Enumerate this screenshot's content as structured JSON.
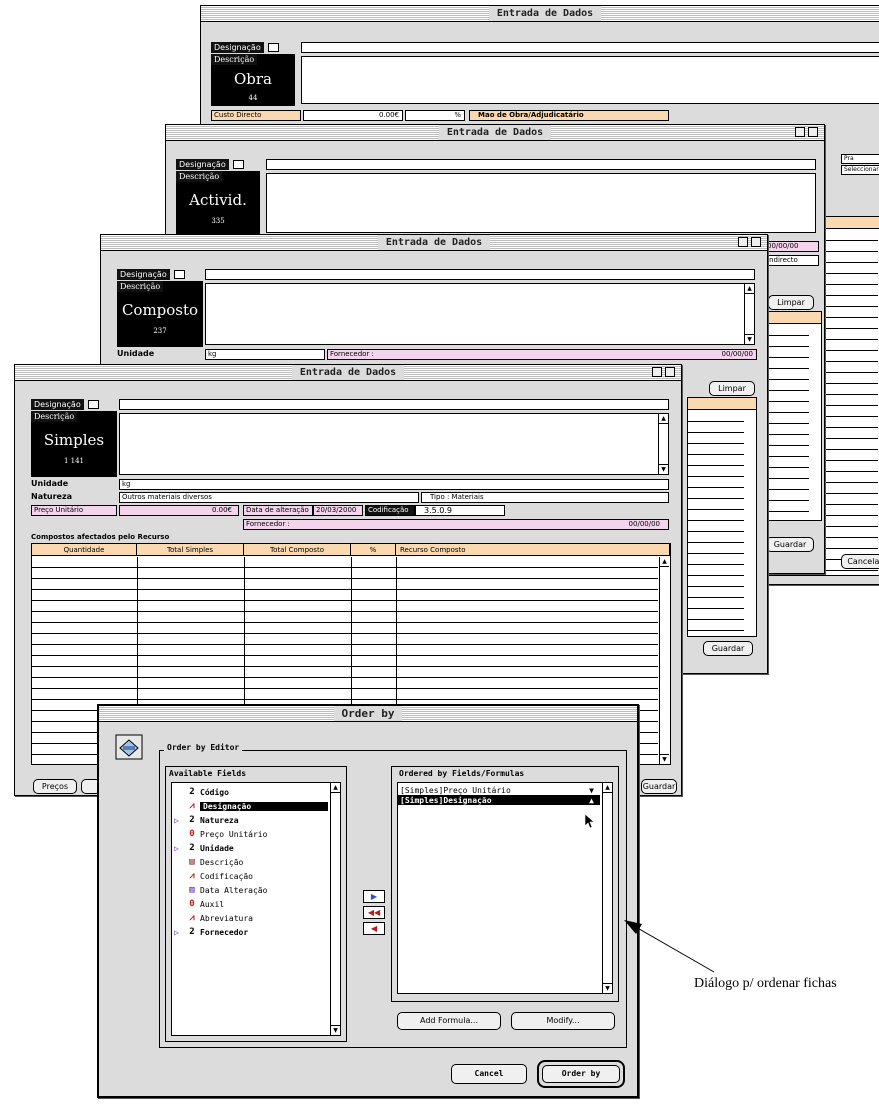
{
  "window_title": "Entrada de Dados",
  "common": {
    "designacao_label": "Designação",
    "descricao_label": "Descrição",
    "unidade_label": "Unidade",
    "limpar": "Limpar",
    "guardar": "Guardar"
  },
  "win_obra": {
    "title": "Entrada de Dados",
    "block_title": "Obra",
    "block_count": "44",
    "custo_label": "Custo Directo",
    "custo_value": "0.00€",
    "pct_symbol": "%",
    "mao_obra_label": "Mao de Obra/Adjudicatário",
    "side_a": "Pra",
    "side_b": "Seleccionar",
    "cancelar": "Cancelar"
  },
  "win_activ": {
    "title": "Entrada de Dados",
    "block_title": "Activid.",
    "block_count": "335",
    "ref_a": "00/00/00",
    "ref_b": "Indirecto"
  },
  "win_composto": {
    "title": "Entrada de Dados",
    "block_title": "Composto",
    "block_count": "237",
    "unidade_value": "kg",
    "fornecedor_label": "Fornecedor :",
    "fornecedor_date": "00/00/00"
  },
  "win_simples": {
    "title": "Entrada de Dados",
    "block_title": "Simples",
    "block_count": "1 141",
    "unidade_value": "kg",
    "natureza_label": "Natureza",
    "natureza_value": "Outros materiais diversos",
    "tipo_value": "Tipo : Materiais",
    "preco_label": "Preço Unitário",
    "preco_value": "0.00€",
    "data_alt_label": "Data de alteração",
    "data_alt_value": "20/03/2000",
    "codificacao_label": "Codificação",
    "codificacao_value": "3.5.0.9",
    "fornecedor_label": "Fornecedor :",
    "fornecedor_date": "00/00/00",
    "compostos_label": "Compostos afectados pelo Recurso",
    "table_headers": [
      "Quantidade",
      "Total Simples",
      "Total Composto",
      "%",
      "Recurso Composto"
    ],
    "precos_button": "Preços"
  },
  "order_by": {
    "title": "Order by",
    "editor_label": "Order by Editor",
    "available_label": "Available Fields",
    "ordered_label": "Ordered by Fields/Formulas",
    "available_fields": [
      {
        "icon": "number",
        "label": "Código",
        "bold": true,
        "expand": false,
        "selected": false
      },
      {
        "icon": "alpha",
        "label": "Designação",
        "bold": true,
        "expand": false,
        "selected": true
      },
      {
        "icon": "number",
        "label": "Natureza",
        "bold": true,
        "expand": true,
        "selected": false
      },
      {
        "icon": "real",
        "label": "Preço Unitário",
        "bold": false,
        "expand": false,
        "selected": false
      },
      {
        "icon": "number",
        "label": "Unidade",
        "bold": true,
        "expand": true,
        "selected": false
      },
      {
        "icon": "text",
        "label": "Descrição",
        "bold": false,
        "expand": false,
        "selected": false
      },
      {
        "icon": "alpha",
        "label": "Codificação",
        "bold": false,
        "expand": false,
        "selected": false
      },
      {
        "icon": "date",
        "label": "Data Alteração",
        "bold": false,
        "expand": false,
        "selected": false
      },
      {
        "icon": "real",
        "label": "Auxil",
        "bold": false,
        "expand": false,
        "selected": false
      },
      {
        "icon": "alpha",
        "label": "Abreviatura",
        "bold": false,
        "expand": false,
        "selected": false
      },
      {
        "icon": "number",
        "label": "Fornecedor",
        "bold": true,
        "expand": true,
        "selected": false
      }
    ],
    "ordered_fields": [
      {
        "label": "[Simples]Preço Unitário",
        "dir": "▼",
        "selected": false
      },
      {
        "label": "[Simples]Designação",
        "dir": "▲",
        "selected": true
      }
    ],
    "add_formula": "Add Formula...",
    "modify": "Modify...",
    "cancel": "Cancel",
    "order_by_button": "Order by"
  },
  "annotation": "Diálogo p/ ordenar fichas",
  "colors": {
    "pink": "#f3d4ec",
    "peach": "#fbd9b0",
    "accent_triangle": "#6a2fb5"
  }
}
